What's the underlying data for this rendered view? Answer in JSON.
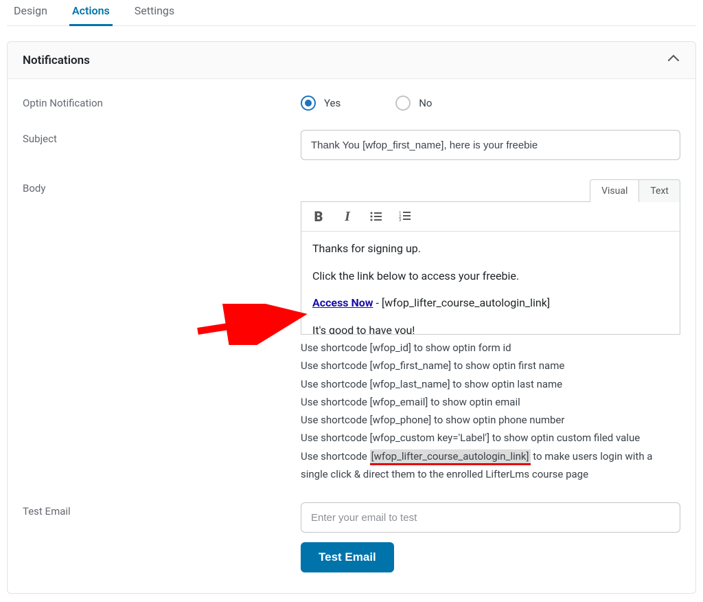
{
  "tabs": [
    "Design",
    "Actions",
    "Settings"
  ],
  "panel": {
    "title": "Notifications",
    "optin_label": "Optin Notification",
    "optin_yes": "Yes",
    "optin_no": "No",
    "subject_label": "Subject",
    "subject_value": "Thank You [wfop_first_name], here is your freebie",
    "body_label": "Body",
    "editor_tabs": {
      "visual": "Visual",
      "text": "Text"
    },
    "body_lines": {
      "l1": "Thanks for signing up.",
      "l2": "Click the link below to access your freebie.",
      "l3_link": "Access Now",
      "l3_sep": " - ",
      "l3_code": "[wfop_lifter_course_autologin_link]",
      "l4": "It's good to have you!"
    },
    "help": {
      "h1": "Use shortcode [wfop_id] to show optin form id",
      "h2": "Use shortcode [wfop_first_name] to show optin first name",
      "h3": "Use shortcode [wfop_last_name] to show optin last name",
      "h4": "Use shortcode [wfop_email] to show optin email",
      "h5": "Use shortcode [wfop_phone] to show optin phone number",
      "h6": "Use shortcode [wfop_custom key='Label'] to show optin custom filed value",
      "h7a": "Use shortcode ",
      "h7b": "[wfop_lifter_course_autologin_link]",
      "h7c": " to make users login with a single click & direct them to the enrolled LifterLms course page"
    },
    "test_label": "Test Email",
    "test_placeholder": "Enter your email to test",
    "test_button": "Test Email"
  }
}
